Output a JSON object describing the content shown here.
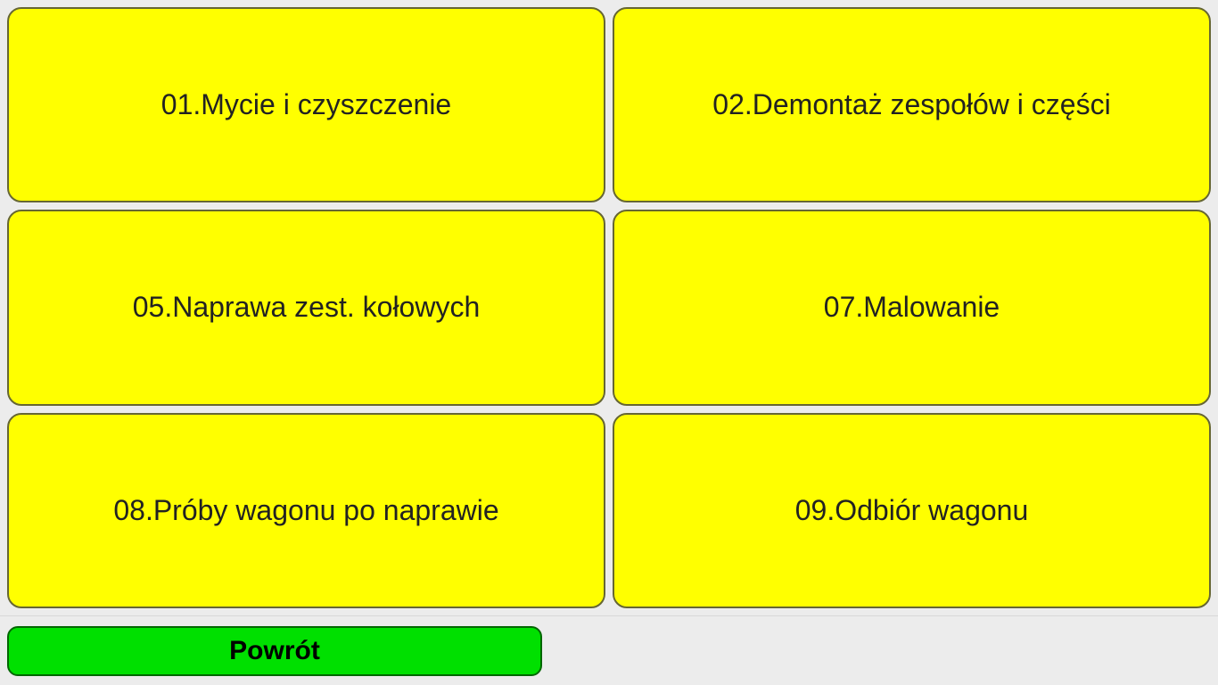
{
  "menu": {
    "items": [
      {
        "label": "01.Mycie i czyszczenie"
      },
      {
        "label": "02.Demontaż zespołów i części"
      },
      {
        "label": "05.Naprawa zest. kołowych"
      },
      {
        "label": "07.Malowanie"
      },
      {
        "label": "08.Próby wagonu po naprawie"
      },
      {
        "label": "09.Odbiór wagonu"
      }
    ]
  },
  "footer": {
    "back_label": "Powrót"
  }
}
